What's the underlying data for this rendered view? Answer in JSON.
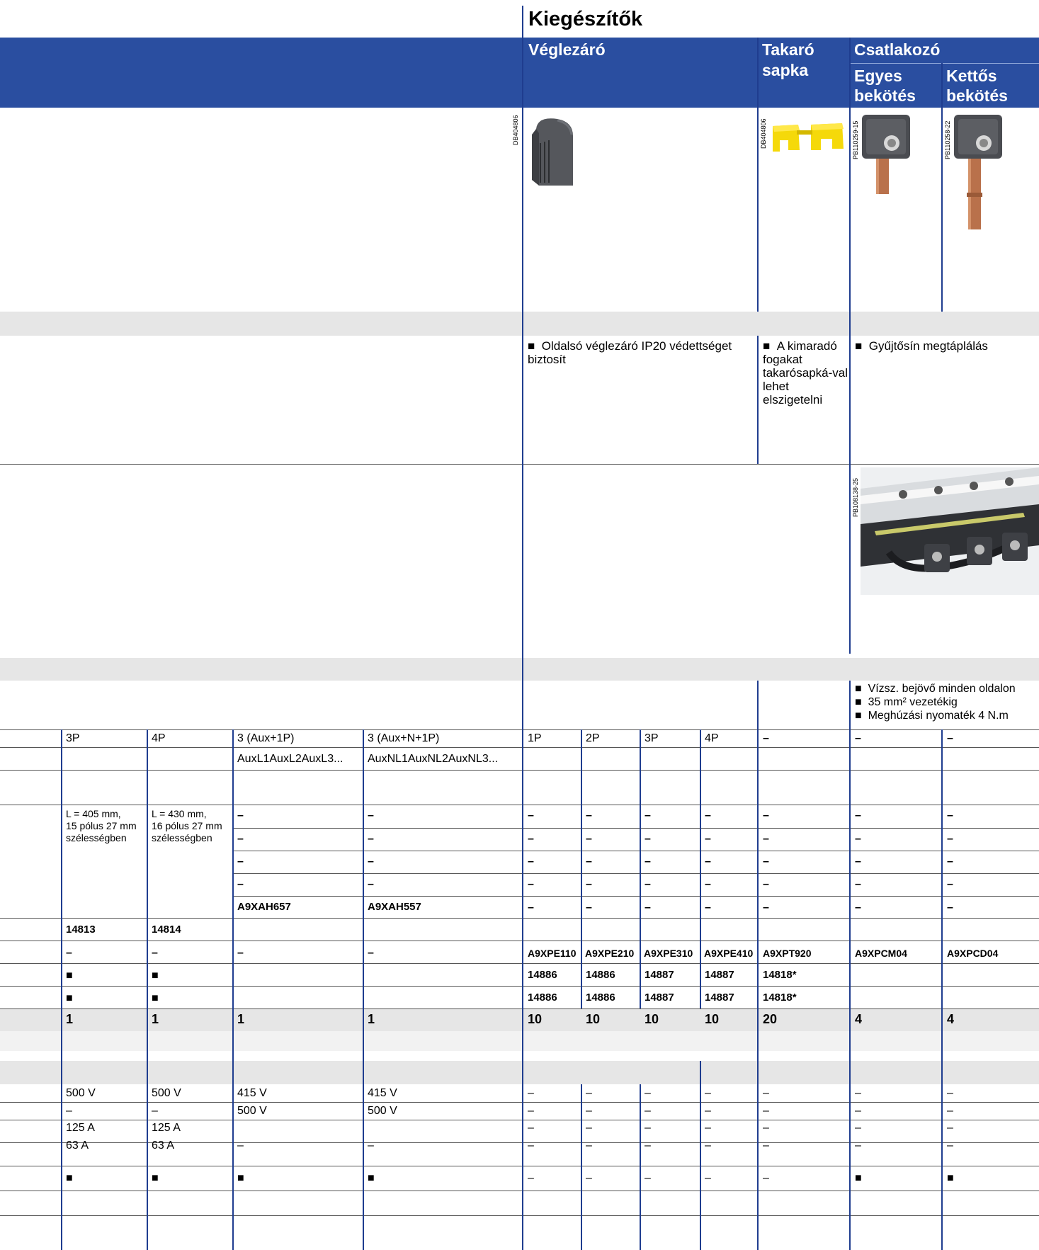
{
  "section_title": "Kiegészítők",
  "header": {
    "veglezaro": "Véglezáró",
    "takaro1": "Takaró",
    "takaro2": "sapka",
    "csatlakozo": "Csatlakozó",
    "egyes1": "Egyes",
    "egyes2": "bekötés",
    "kettos1": "Kettős",
    "kettos2": "bekötés"
  },
  "image_codes": {
    "veglezaro": "DB404806",
    "takaro": "DB404806",
    "egyes": "PB110259-15",
    "kettos": "PB110258-22",
    "busbar": "PB108138-25"
  },
  "descriptions": {
    "veglezaro": "Oldalsó véglezáró IP20 védettséget biztosít",
    "takaro": "A kimaradó fogakat takarósapká-val lehet elszigetelni",
    "csatlakozo": "Gyűjtősín megtáplálás"
  },
  "conn_notes": [
    "Vízsz. bejövő minden oldalon",
    "35 mm² vezetékig",
    "Meghúzási nyomaték 4 N.m"
  ],
  "bullet": "■",
  "dash": "–",
  "row_poles": [
    "3P",
    "4P",
    "3 (Aux+1P)",
    "3 (Aux+N+1P)",
    "1P",
    "2P",
    "3P",
    "4P",
    "–",
    "–",
    "–"
  ],
  "row_aux": [
    "AuxL1AuxL2AuxL3...",
    "AuxNL1AuxNL2AuxNL3..."
  ],
  "length_desc": [
    "L = 405 mm,\n15 pólus 27 mm\nszélességben",
    "L = 430 mm,\n16 pólus 27 mm\nszélességben"
  ],
  "codes_a9xah": [
    "A9XAH657",
    "A9XAH557"
  ],
  "codes_148": [
    "14813",
    "14814"
  ],
  "codes_a9x": [
    "A9XPE110",
    "A9XPE210",
    "A9XPE310",
    "A9XPE410",
    "A9XPT920",
    "A9XPCM04",
    "A9XPCD04"
  ],
  "codes_ref": [
    "14886",
    "14886",
    "14887",
    "14887",
    "14818*"
  ],
  "qty": [
    "1",
    "1",
    "1",
    "1",
    "10",
    "10",
    "10",
    "10",
    "20",
    "4",
    "4"
  ],
  "voltage1": [
    "500 V",
    "500 V",
    "415 V",
    "415 V"
  ],
  "voltage2": [
    "–",
    "–",
    "500 V",
    "500 V"
  ],
  "current1": [
    "125 A",
    "125 A"
  ],
  "current2": [
    "63 A",
    "63 A"
  ]
}
